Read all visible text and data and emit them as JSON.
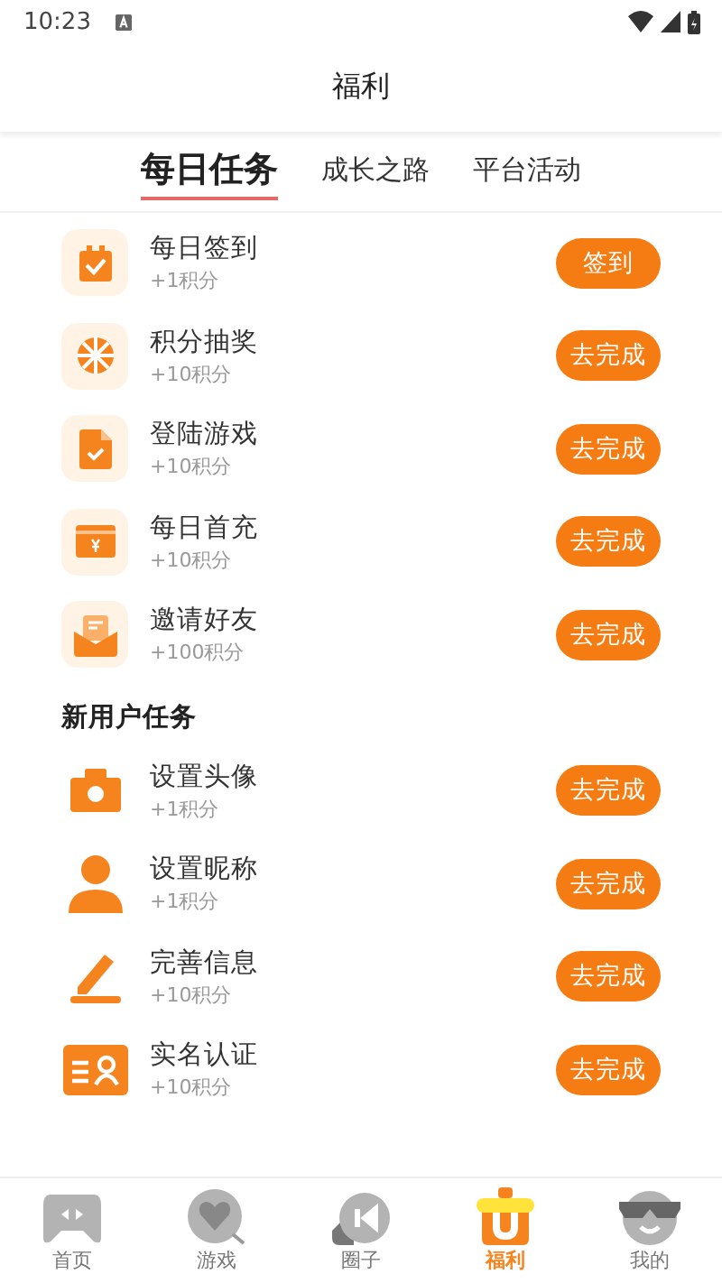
{
  "status_bar": {
    "time": "10:23"
  },
  "header": {
    "title": "福利"
  },
  "tabs": [
    {
      "label": "每日任务",
      "selected": true
    },
    {
      "label": "成长之路",
      "selected": false
    },
    {
      "label": "平台活动",
      "selected": false
    }
  ],
  "sections": [
    {
      "boxed": true,
      "tasks": [
        {
          "title": "每日签到",
          "points": "+1积分",
          "button": "签到"
        },
        {
          "title": "积分抽奖",
          "points": "+10积分",
          "button": "去完成"
        },
        {
          "title": "登陆游戏",
          "points": "+10积分",
          "button": "去完成"
        },
        {
          "title": "每日首充",
          "points": "+10积分",
          "button": "去完成"
        },
        {
          "title": "邀请好友",
          "points": "+100积分",
          "button": "去完成"
        }
      ]
    },
    {
      "heading": "新用户任务",
      "boxed": false,
      "tasks": [
        {
          "title": "设置头像",
          "points": "+1积分",
          "button": "去完成"
        },
        {
          "title": "设置昵称",
          "points": "+1积分",
          "button": "去完成"
        },
        {
          "title": "完善信息",
          "points": "+10积分",
          "button": "去完成"
        },
        {
          "title": "实名认证",
          "points": "+10积分",
          "button": "去完成"
        }
      ]
    }
  ],
  "nav": [
    {
      "label": "首页",
      "selected": false
    },
    {
      "label": "游戏",
      "selected": false
    },
    {
      "label": "圈子",
      "selected": false
    },
    {
      "label": "福利",
      "selected": true
    },
    {
      "label": "我的",
      "selected": false
    }
  ]
}
